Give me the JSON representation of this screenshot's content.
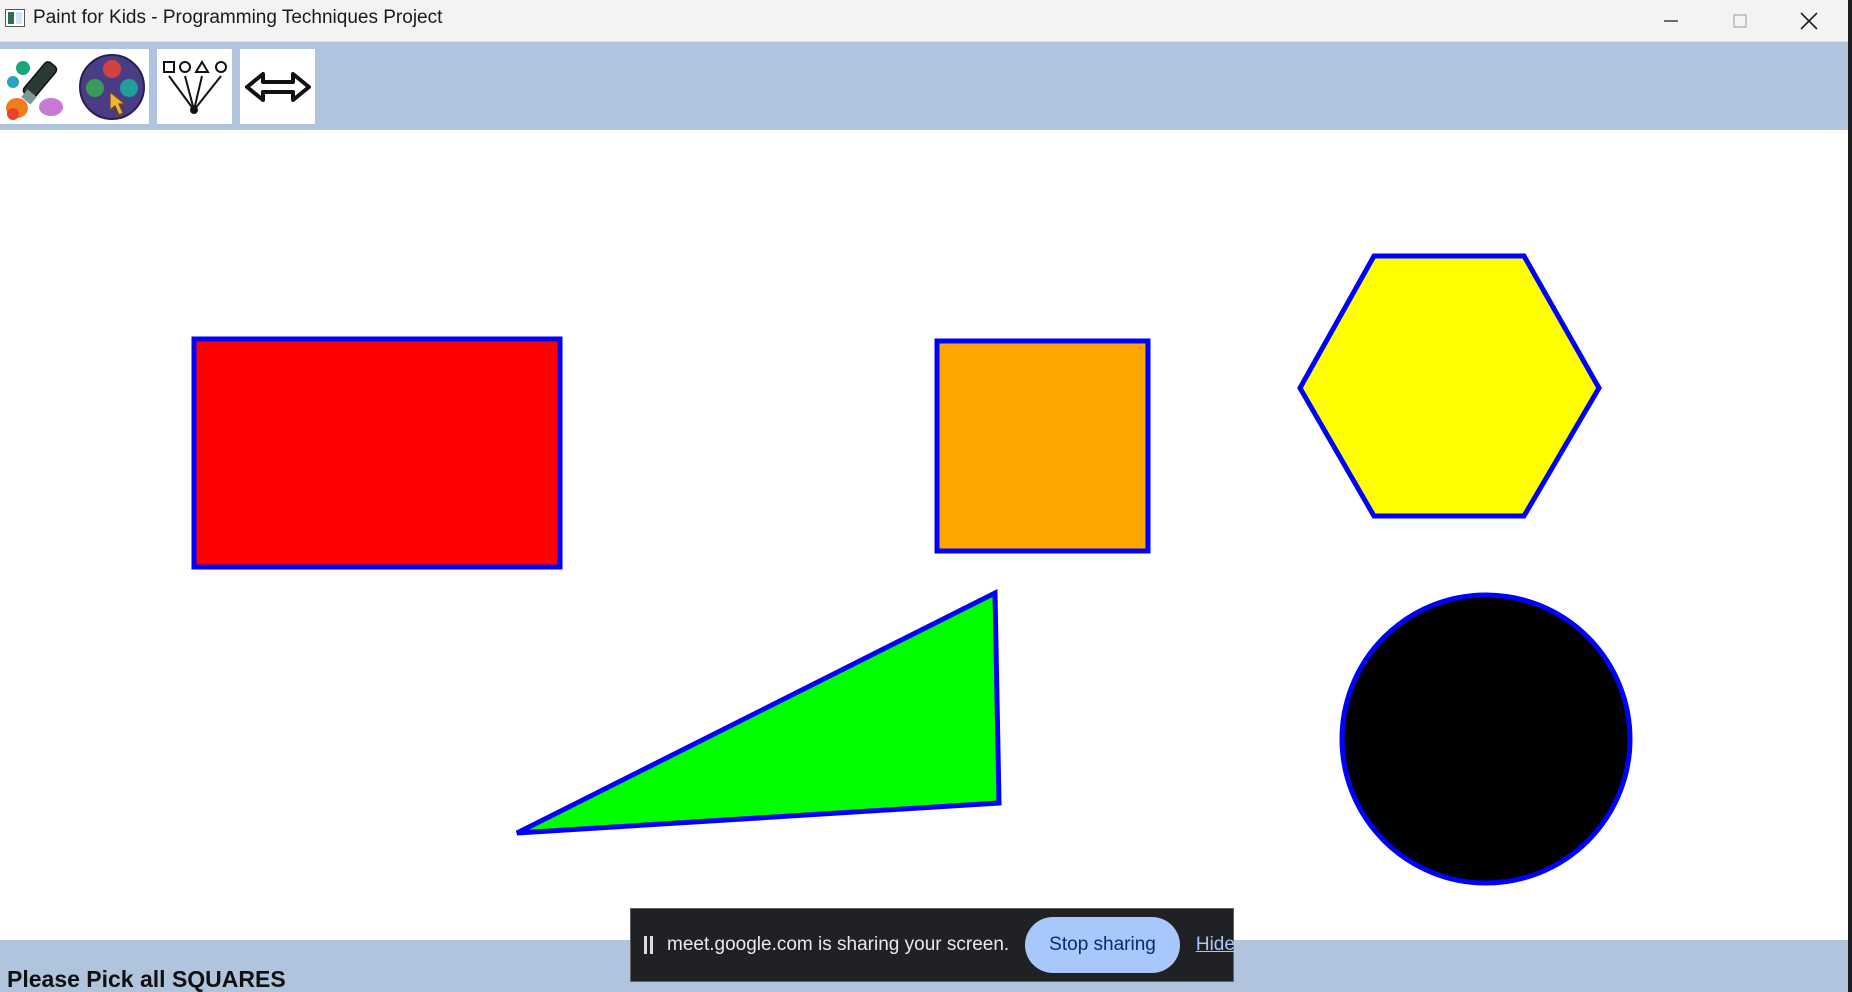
{
  "window": {
    "title": "Paint for Kids - Programming Techniques Project"
  },
  "toolbar": {
    "tools": [
      {
        "name": "draw-mode",
        "icon": "paint-brush-icon"
      },
      {
        "name": "color-picker",
        "icon": "color-palette-icon"
      },
      {
        "name": "pick-shape",
        "icon": "shapes-tree-icon"
      },
      {
        "name": "switch-mode",
        "icon": "double-arrow-icon"
      }
    ]
  },
  "canvas": {
    "shapes": [
      {
        "type": "rectangle",
        "fill": "#ff0000",
        "border": "#0000ff"
      },
      {
        "type": "square",
        "fill": "#ffa500",
        "border": "#0000ff"
      },
      {
        "type": "hexagon",
        "fill": "#ffff00",
        "border": "#0000ff"
      },
      {
        "type": "triangle",
        "fill": "#00ff00",
        "border": "#0000ff"
      },
      {
        "type": "circle",
        "fill": "#000000",
        "border": "#0000ff"
      }
    ]
  },
  "status": {
    "message": "Please Pick all SQUARES"
  },
  "screen_share": {
    "message": "meet.google.com is sharing your screen.",
    "stop_label": "Stop sharing",
    "hide_label": "Hide"
  },
  "colors": {
    "toolbar_bg": "#b0c4de",
    "shape_border": "#0000ff",
    "stop_button": "#a8c7fa"
  }
}
